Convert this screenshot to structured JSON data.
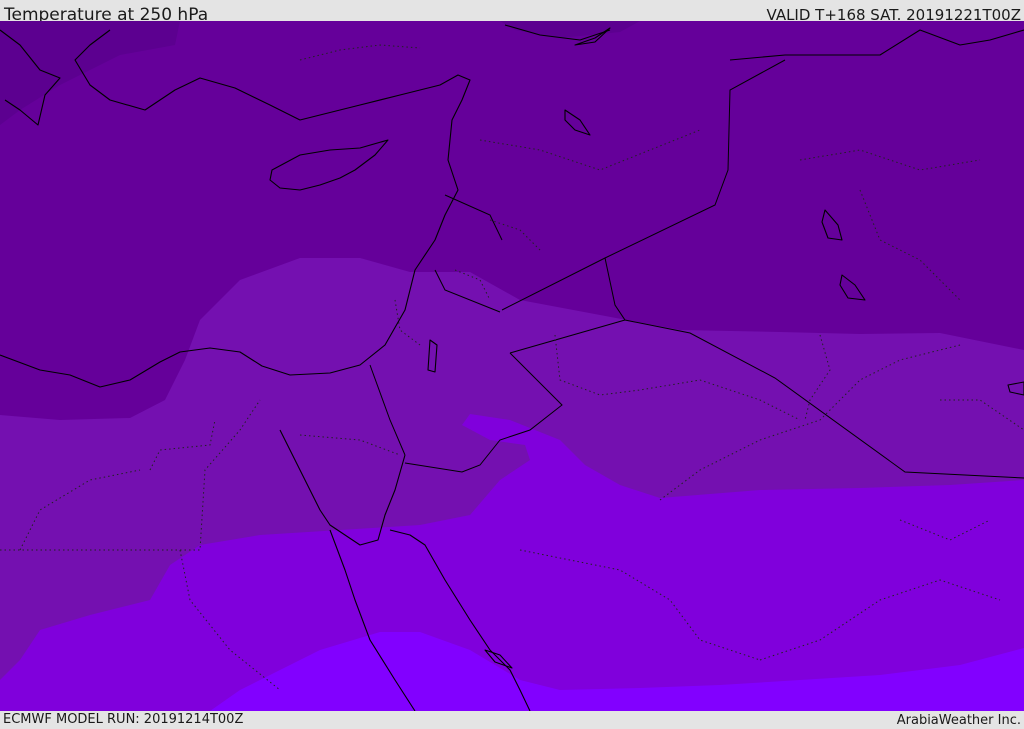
{
  "header": {
    "title": "Temperature at 250 hPa",
    "valid": "VALID T+168 SAT. 20191221T00Z"
  },
  "footer": {
    "model_run": "ECMWF MODEL RUN: 20191214T00Z",
    "credit": "ArabiaWeather Inc."
  },
  "map": {
    "field": "Temperature at 250 hPa",
    "colors": {
      "band_coldest": "#5c0090",
      "band_cold": "#65009a",
      "band_mid": "#7410b0",
      "band_warm": "#8000dc",
      "band_warmest": "#8200ff"
    }
  }
}
